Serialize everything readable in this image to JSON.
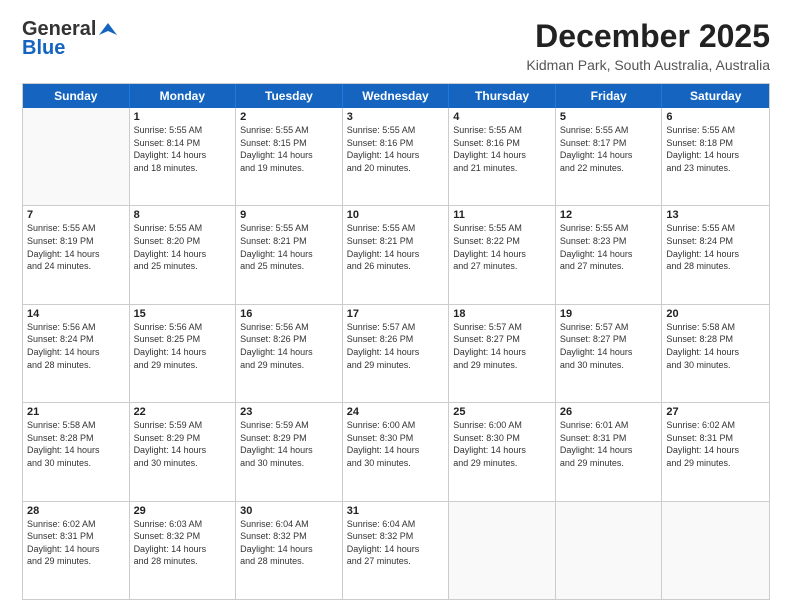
{
  "header": {
    "logo_general": "General",
    "logo_blue": "Blue",
    "title": "December 2025",
    "subtitle": "Kidman Park, South Australia, Australia"
  },
  "days": [
    "Sunday",
    "Monday",
    "Tuesday",
    "Wednesday",
    "Thursday",
    "Friday",
    "Saturday"
  ],
  "weeks": [
    [
      {
        "day": "",
        "content": ""
      },
      {
        "day": "1",
        "content": "Sunrise: 5:55 AM\nSunset: 8:14 PM\nDaylight: 14 hours\nand 18 minutes."
      },
      {
        "day": "2",
        "content": "Sunrise: 5:55 AM\nSunset: 8:15 PM\nDaylight: 14 hours\nand 19 minutes."
      },
      {
        "day": "3",
        "content": "Sunrise: 5:55 AM\nSunset: 8:16 PM\nDaylight: 14 hours\nand 20 minutes."
      },
      {
        "day": "4",
        "content": "Sunrise: 5:55 AM\nSunset: 8:16 PM\nDaylight: 14 hours\nand 21 minutes."
      },
      {
        "day": "5",
        "content": "Sunrise: 5:55 AM\nSunset: 8:17 PM\nDaylight: 14 hours\nand 22 minutes."
      },
      {
        "day": "6",
        "content": "Sunrise: 5:55 AM\nSunset: 8:18 PM\nDaylight: 14 hours\nand 23 minutes."
      }
    ],
    [
      {
        "day": "7",
        "content": "Sunrise: 5:55 AM\nSunset: 8:19 PM\nDaylight: 14 hours\nand 24 minutes."
      },
      {
        "day": "8",
        "content": "Sunrise: 5:55 AM\nSunset: 8:20 PM\nDaylight: 14 hours\nand 25 minutes."
      },
      {
        "day": "9",
        "content": "Sunrise: 5:55 AM\nSunset: 8:21 PM\nDaylight: 14 hours\nand 25 minutes."
      },
      {
        "day": "10",
        "content": "Sunrise: 5:55 AM\nSunset: 8:21 PM\nDaylight: 14 hours\nand 26 minutes."
      },
      {
        "day": "11",
        "content": "Sunrise: 5:55 AM\nSunset: 8:22 PM\nDaylight: 14 hours\nand 27 minutes."
      },
      {
        "day": "12",
        "content": "Sunrise: 5:55 AM\nSunset: 8:23 PM\nDaylight: 14 hours\nand 27 minutes."
      },
      {
        "day": "13",
        "content": "Sunrise: 5:55 AM\nSunset: 8:24 PM\nDaylight: 14 hours\nand 28 minutes."
      }
    ],
    [
      {
        "day": "14",
        "content": "Sunrise: 5:56 AM\nSunset: 8:24 PM\nDaylight: 14 hours\nand 28 minutes."
      },
      {
        "day": "15",
        "content": "Sunrise: 5:56 AM\nSunset: 8:25 PM\nDaylight: 14 hours\nand 29 minutes."
      },
      {
        "day": "16",
        "content": "Sunrise: 5:56 AM\nSunset: 8:26 PM\nDaylight: 14 hours\nand 29 minutes."
      },
      {
        "day": "17",
        "content": "Sunrise: 5:57 AM\nSunset: 8:26 PM\nDaylight: 14 hours\nand 29 minutes."
      },
      {
        "day": "18",
        "content": "Sunrise: 5:57 AM\nSunset: 8:27 PM\nDaylight: 14 hours\nand 29 minutes."
      },
      {
        "day": "19",
        "content": "Sunrise: 5:57 AM\nSunset: 8:27 PM\nDaylight: 14 hours\nand 30 minutes."
      },
      {
        "day": "20",
        "content": "Sunrise: 5:58 AM\nSunset: 8:28 PM\nDaylight: 14 hours\nand 30 minutes."
      }
    ],
    [
      {
        "day": "21",
        "content": "Sunrise: 5:58 AM\nSunset: 8:28 PM\nDaylight: 14 hours\nand 30 minutes."
      },
      {
        "day": "22",
        "content": "Sunrise: 5:59 AM\nSunset: 8:29 PM\nDaylight: 14 hours\nand 30 minutes."
      },
      {
        "day": "23",
        "content": "Sunrise: 5:59 AM\nSunset: 8:29 PM\nDaylight: 14 hours\nand 30 minutes."
      },
      {
        "day": "24",
        "content": "Sunrise: 6:00 AM\nSunset: 8:30 PM\nDaylight: 14 hours\nand 30 minutes."
      },
      {
        "day": "25",
        "content": "Sunrise: 6:00 AM\nSunset: 8:30 PM\nDaylight: 14 hours\nand 29 minutes."
      },
      {
        "day": "26",
        "content": "Sunrise: 6:01 AM\nSunset: 8:31 PM\nDaylight: 14 hours\nand 29 minutes."
      },
      {
        "day": "27",
        "content": "Sunrise: 6:02 AM\nSunset: 8:31 PM\nDaylight: 14 hours\nand 29 minutes."
      }
    ],
    [
      {
        "day": "28",
        "content": "Sunrise: 6:02 AM\nSunset: 8:31 PM\nDaylight: 14 hours\nand 29 minutes."
      },
      {
        "day": "29",
        "content": "Sunrise: 6:03 AM\nSunset: 8:32 PM\nDaylight: 14 hours\nand 28 minutes."
      },
      {
        "day": "30",
        "content": "Sunrise: 6:04 AM\nSunset: 8:32 PM\nDaylight: 14 hours\nand 28 minutes."
      },
      {
        "day": "31",
        "content": "Sunrise: 6:04 AM\nSunset: 8:32 PM\nDaylight: 14 hours\nand 27 minutes."
      },
      {
        "day": "",
        "content": ""
      },
      {
        "day": "",
        "content": ""
      },
      {
        "day": "",
        "content": ""
      }
    ]
  ]
}
